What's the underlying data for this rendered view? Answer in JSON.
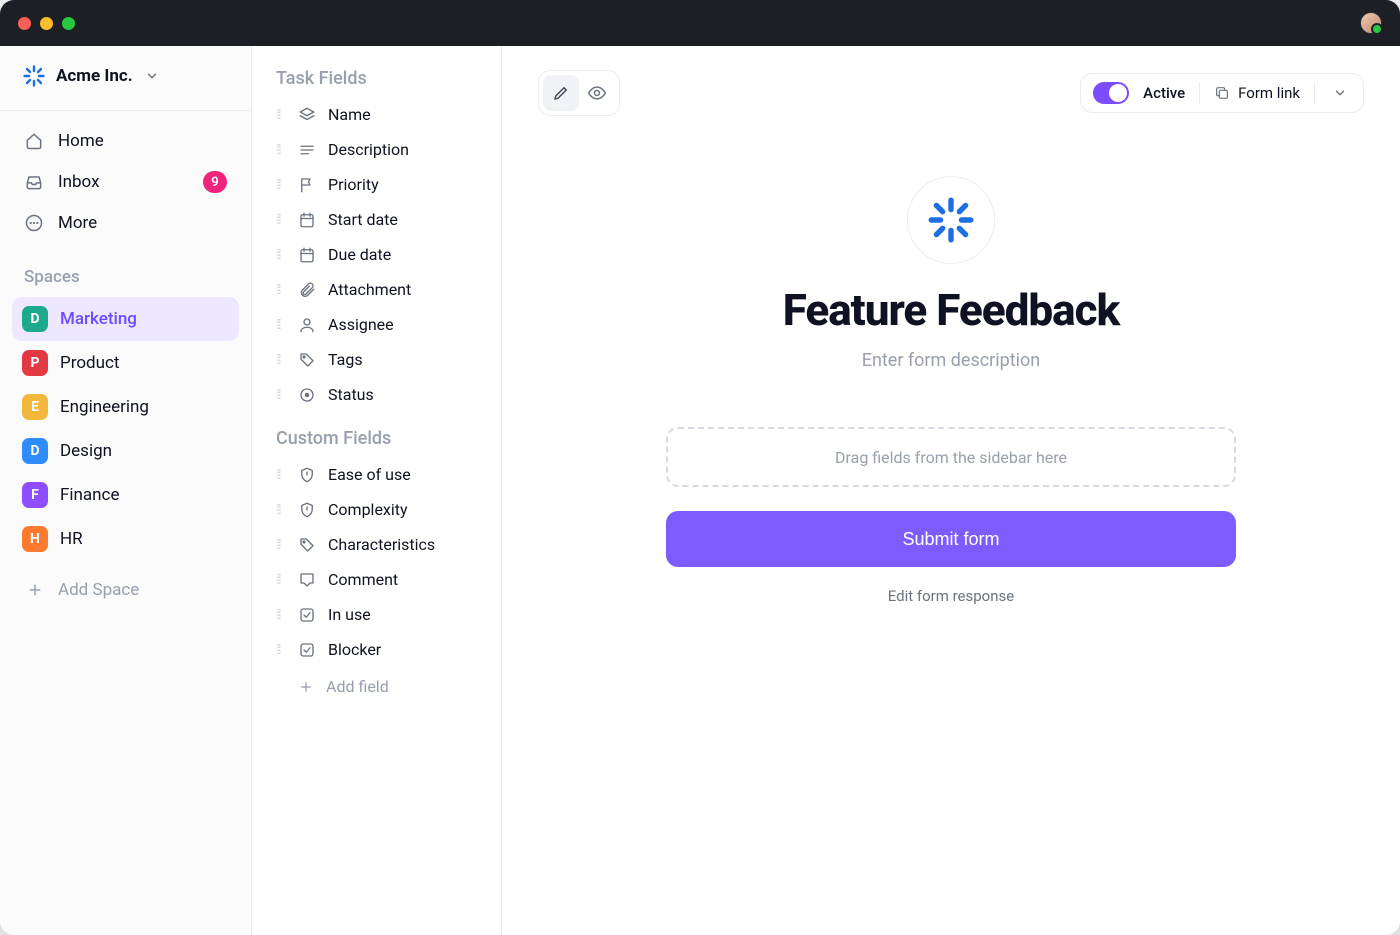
{
  "org": {
    "name": "Acme Inc."
  },
  "nav": {
    "home": "Home",
    "inbox": {
      "label": "Inbox",
      "badge": "9"
    },
    "more": "More"
  },
  "spaces": {
    "heading": "Spaces",
    "add_label": "Add Space",
    "items": [
      {
        "letter": "D",
        "name": "Marketing",
        "color": "#1DAA8C",
        "selected": true
      },
      {
        "letter": "P",
        "name": "Product",
        "color": "#E23942"
      },
      {
        "letter": "E",
        "name": "Engineering",
        "color": "#F2B73B"
      },
      {
        "letter": "D",
        "name": "Design",
        "color": "#2F8CFF"
      },
      {
        "letter": "F",
        "name": "Finance",
        "color": "#8E4DFF"
      },
      {
        "letter": "H",
        "name": "HR",
        "color": "#FF7A2F"
      }
    ]
  },
  "fields": {
    "task_heading": "Task Fields",
    "custom_heading": "Custom Fields",
    "add_label": "Add field",
    "task": [
      {
        "name": "Name",
        "icon": "layers"
      },
      {
        "name": "Description",
        "icon": "text"
      },
      {
        "name": "Priority",
        "icon": "flag"
      },
      {
        "name": "Start date",
        "icon": "calendar"
      },
      {
        "name": "Due date",
        "icon": "calendar"
      },
      {
        "name": "Attachment",
        "icon": "paperclip"
      },
      {
        "name": "Assignee",
        "icon": "person"
      },
      {
        "name": "Tags",
        "icon": "tag"
      },
      {
        "name": "Status",
        "icon": "circle-dot"
      }
    ],
    "custom": [
      {
        "name": "Ease of use",
        "icon": "shield"
      },
      {
        "name": "Complexity",
        "icon": "shield"
      },
      {
        "name": "Characteristics",
        "icon": "tag"
      },
      {
        "name": "Comment",
        "icon": "comment"
      },
      {
        "name": "In use",
        "icon": "checkbox"
      },
      {
        "name": "Blocker",
        "icon": "checkbox"
      }
    ]
  },
  "canvas": {
    "status_label": "Active",
    "form_link_label": "Form link",
    "title": "Feature Feedback",
    "desc_placeholder": "Enter form description",
    "dropzone": "Drag fields from the sidebar here",
    "submit_label": "Submit form",
    "edit_response": "Edit form response"
  }
}
